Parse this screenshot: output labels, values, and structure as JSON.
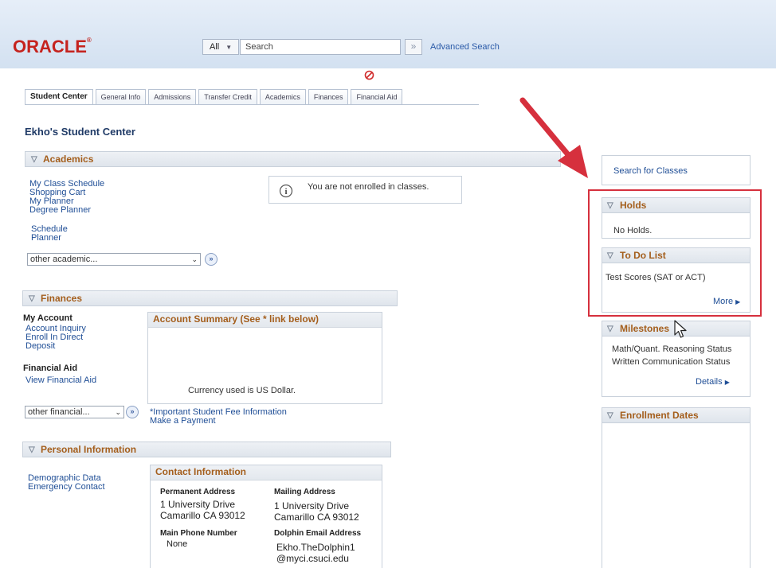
{
  "header": {
    "logo": "ORACLE",
    "logo_tm": "®",
    "search_scope": "All",
    "search_placeholder": "Search",
    "search_go": "»",
    "advanced_search": "Advanced Search"
  },
  "tabs": [
    "Student Center",
    "General Info",
    "Admissions",
    "Transfer Credit",
    "Academics",
    "Finances",
    "Financial Aid"
  ],
  "page_title": "Ekho's Student Center",
  "academics": {
    "header": "Academics",
    "links_group1": [
      "My Class Schedule",
      "Shopping Cart",
      "My Planner",
      "Degree Planner"
    ],
    "links_group2": [
      "Schedule",
      "Planner"
    ],
    "dropdown": "other academic...",
    "go": "»",
    "info_message": "You are not enrolled in classes."
  },
  "finances": {
    "header": "Finances",
    "my_account_label": "My Account",
    "my_account_links": [
      "Account Inquiry",
      "Enroll In Direct",
      "Deposit"
    ],
    "financial_aid_label": "Financial Aid",
    "financial_aid_links": [
      "View Financial Aid"
    ],
    "summary_title": "Account Summary (See * link below)",
    "currency_note": "Currency used is US Dollar.",
    "dropdown": "other financial...",
    "go": "»",
    "bottom_links": [
      "*Important Student Fee Information",
      "Make a Payment"
    ]
  },
  "personal": {
    "header": "Personal Information",
    "links": [
      "Demographic Data",
      "Emergency Contact"
    ],
    "contact_title": "Contact Information",
    "permanent_label": "Permanent Address",
    "permanent_line1": "1 University Drive",
    "permanent_line2": "Camarillo CA 93012",
    "mailing_label": "Mailing Address",
    "mailing_line1": "1 University Drive",
    "mailing_line2": "Camarillo CA 93012",
    "phone_label": "Main Phone Number",
    "phone_value": "None",
    "email_label": "Dolphin Email Address",
    "email_line1": "Ekho.TheDolphin1",
    "email_line2": "@myci.csuci.edu"
  },
  "sidebar": {
    "search_classes": "Search for Classes",
    "holds_header": "Holds",
    "holds_text": "No Holds.",
    "todo_header": "To Do List",
    "todo_item": "Test Scores (SAT or ACT)",
    "todo_more": "More",
    "milestones_header": "Milestones",
    "milestones_items": [
      "Math/Quant. Reasoning Status",
      "Written Communication Status"
    ],
    "milestones_details": "Details",
    "enrollment_header": "Enrollment Dates"
  },
  "colors": {
    "accent_header_text": "#a45e1c",
    "link": "#1f4e96",
    "annotation_red": "#d6303d"
  }
}
